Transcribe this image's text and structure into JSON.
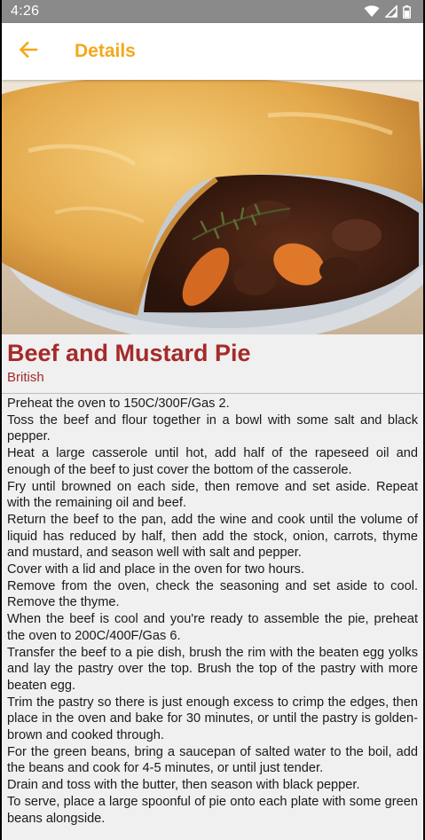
{
  "status_bar": {
    "time": "4:26",
    "icons": [
      "wifi-icon",
      "signal-icon",
      "battery-icon"
    ]
  },
  "app_bar": {
    "back_icon": "arrow-left-icon",
    "title": "Details",
    "accent_color": "#f4a81a"
  },
  "meal": {
    "image_alt": "beef-and-mustard-pie-photo",
    "name": "Beef and Mustard Pie",
    "area": "British",
    "title_color": "#a52a2a",
    "instructions": [
      "Preheat the oven to 150C/300F/Gas 2.",
      "Toss the beef and flour together in a bowl with some salt and black pepper.",
      "Heat a large casserole until hot, add half of the rapeseed oil and enough of the beef to just cover the bottom of the casserole.",
      "Fry until browned on each side, then remove and set aside. Repeat with the remaining oil and beef.",
      "Return the beef to the pan, add the wine and cook until the volume of liquid has reduced by half, then add the stock, onion, carrots, thyme and mustard, and season well with salt and pepper.",
      "Cover with a lid and place in the oven for two hours.",
      "Remove from the oven, check the seasoning and set aside to cool. Remove the thyme.",
      "When the beef is cool and you're ready to assemble the pie, preheat the oven to 200C/400F/Gas 6.",
      "Transfer the beef to a pie dish, brush the rim with the beaten egg yolks and lay the pastry over the top. Brush the top of the pastry with more beaten egg.",
      "Trim the pastry so there is just enough excess to crimp the edges, then place in the oven and bake for 30 minutes, or until the pastry is golden-brown and cooked through.",
      "For the green beans, bring a saucepan of salted water to the boil, add the beans and cook for 4-5 minutes, or until just tender.",
      "Drain and toss with the butter, then season with black pepper.",
      "To serve, place a large spoonful of pie onto each plate with some green beans alongside."
    ]
  }
}
